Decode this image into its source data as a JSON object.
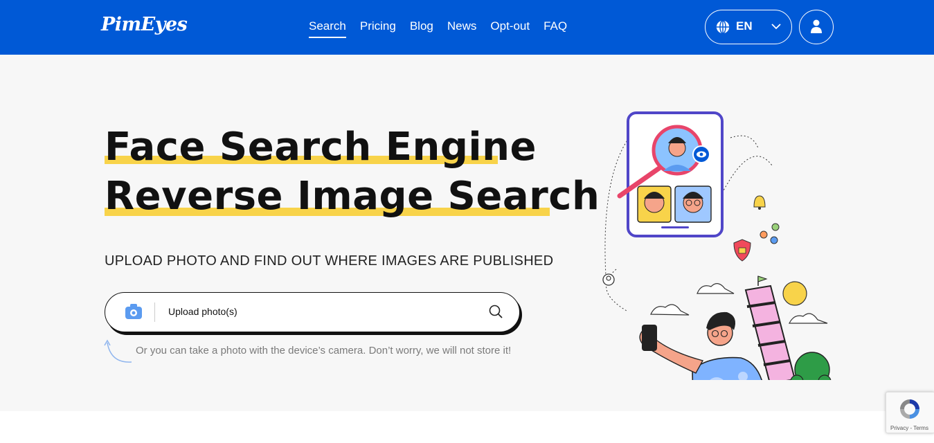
{
  "brand": {
    "logo_text": "PimEyes"
  },
  "nav": {
    "items": [
      "Search",
      "Pricing",
      "Blog",
      "News",
      "Opt-out",
      "FAQ"
    ],
    "active": "Search"
  },
  "lang": {
    "code": "EN"
  },
  "hero": {
    "title_line1": "Face Search Engine",
    "title_line2": "Reverse Image Search",
    "subtitle": "UPLOAD PHOTO AND FIND OUT WHERE IMAGES ARE PUBLISHED",
    "upload_label": "Upload photo(s)",
    "hint": "Or you can take a photo with the device’s camera. Don’t worry, we will not store it!"
  },
  "recaptcha": {
    "links": "Privacy - Terms"
  },
  "colors": {
    "brand_blue": "#0059d6",
    "highlight_yellow": "#f8d34a",
    "hero_bg": "#f7f7f7"
  }
}
